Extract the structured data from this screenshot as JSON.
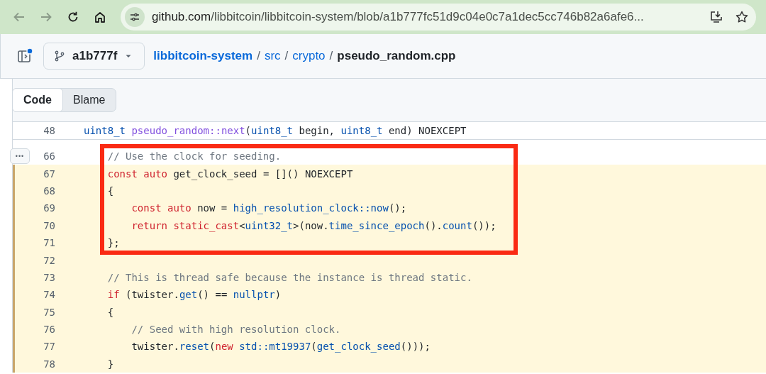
{
  "browser": {
    "nav": [
      {
        "kind": "back",
        "disabled": true
      },
      {
        "kind": "forward",
        "disabled": true
      },
      {
        "kind": "reload",
        "disabled": false
      },
      {
        "kind": "home",
        "disabled": false
      }
    ],
    "address": {
      "host": "github.com",
      "path": "/libbitcoin/libbitcoin-system/blob/a1b777fc51d9c04e0c7a1dec5cc746b82a6afe6..."
    }
  },
  "file_header": {
    "branch": "a1b777f",
    "breadcrumb": [
      {
        "text": "libbitcoin-system",
        "kind": "repo"
      },
      {
        "text": "/",
        "kind": "sep"
      },
      {
        "text": "src",
        "kind": "link"
      },
      {
        "text": "/",
        "kind": "sep"
      },
      {
        "text": "crypto",
        "kind": "link"
      },
      {
        "text": "/",
        "kind": "sep"
      },
      {
        "text": "pseudo_random.cpp",
        "kind": "file"
      }
    ]
  },
  "tabs": [
    {
      "label": "Code",
      "selected": true
    },
    {
      "label": "Blame",
      "selected": false
    }
  ],
  "sticky_line": {
    "number": "48",
    "tokens": [
      {
        "text": "uint8_t",
        "kind": "type"
      },
      {
        "text": " pseudo_random::next",
        "kind": "entity"
      },
      {
        "text": "(",
        "kind": "plain"
      },
      {
        "text": "uint8_t",
        "kind": "type"
      },
      {
        "text": " begin, ",
        "kind": "plain"
      },
      {
        "text": "uint8_t",
        "kind": "type"
      },
      {
        "text": " end) NOEXCEPT",
        "kind": "plain"
      }
    ]
  },
  "expand_button": "•••",
  "blocks": [
    {
      "boxed": true,
      "lines": [
        {
          "number": "66",
          "highlighted": false,
          "tokens": [
            {
              "text": "    // Use the clock for seeding.",
              "kind": "comment"
            }
          ]
        },
        {
          "number": "67",
          "highlighted": true,
          "tokens": [
            {
              "text": "    const auto",
              "kind": "keyword"
            },
            {
              "text": " get_clock_seed = []() NOEXCEPT",
              "kind": "plain"
            }
          ]
        },
        {
          "number": "68",
          "highlighted": true,
          "tokens": [
            {
              "text": "    {",
              "kind": "plain"
            }
          ]
        },
        {
          "number": "69",
          "highlighted": true,
          "tokens": [
            {
              "text": "        const auto",
              "kind": "keyword"
            },
            {
              "text": " now = ",
              "kind": "plain"
            },
            {
              "text": "high_resolution_clock::now",
              "kind": "type"
            },
            {
              "text": "();",
              "kind": "plain"
            }
          ]
        },
        {
          "number": "70",
          "highlighted": true,
          "tokens": [
            {
              "text": "        return static_cast",
              "kind": "keyword"
            },
            {
              "text": "<",
              "kind": "plain"
            },
            {
              "text": "uint32_t",
              "kind": "type"
            },
            {
              "text": ">(now.",
              "kind": "plain"
            },
            {
              "text": "time_since_epoch",
              "kind": "type"
            },
            {
              "text": "().",
              "kind": "plain"
            },
            {
              "text": "count",
              "kind": "type"
            },
            {
              "text": "());",
              "kind": "plain"
            }
          ]
        },
        {
          "number": "71",
          "highlighted": true,
          "tokens": [
            {
              "text": "    };",
              "kind": "plain"
            }
          ]
        }
      ]
    },
    {
      "lines": [
        {
          "number": "72",
          "highlighted": true
        },
        {
          "number": "73",
          "highlighted": true,
          "tokens": [
            {
              "text": "    // This is thread safe because the instance is thread static.",
              "kind": "comment"
            }
          ]
        },
        {
          "number": "74",
          "highlighted": true,
          "tokens": [
            {
              "text": "    if",
              "kind": "keyword"
            },
            {
              "text": " (twister.",
              "kind": "plain"
            },
            {
              "text": "get",
              "kind": "type"
            },
            {
              "text": "() == ",
              "kind": "plain"
            },
            {
              "text": "nullptr",
              "kind": "type"
            },
            {
              "text": ")",
              "kind": "plain"
            }
          ]
        },
        {
          "number": "75",
          "highlighted": true,
          "tokens": [
            {
              "text": "    {",
              "kind": "plain"
            }
          ]
        },
        {
          "number": "76",
          "highlighted": true,
          "tokens": [
            {
              "text": "        // Seed with high resolution clock.",
              "kind": "comment"
            }
          ]
        },
        {
          "number": "77",
          "highlighted": true,
          "tokens": [
            {
              "text": "        twister.",
              "kind": "plain"
            },
            {
              "text": "reset",
              "kind": "type"
            },
            {
              "text": "(",
              "kind": "plain"
            },
            {
              "text": "new ",
              "kind": "keyword"
            },
            {
              "text": "std::mt19937",
              "kind": "type"
            },
            {
              "text": "(",
              "kind": "plain"
            },
            {
              "text": "get_clock_seed",
              "kind": "type"
            },
            {
              "text": "()));",
              "kind": "plain"
            }
          ]
        },
        {
          "number": "78",
          "highlighted": true,
          "tokens": [
            {
              "text": "    }",
              "kind": "plain"
            }
          ]
        }
      ]
    }
  ]
}
